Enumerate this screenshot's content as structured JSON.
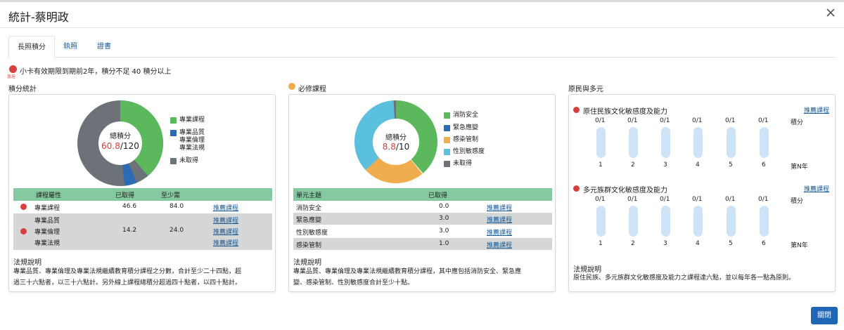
{
  "header": {
    "title": "統計-蔡明政"
  },
  "tabs": [
    {
      "label": "長照積分"
    },
    {
      "label": "執照"
    },
    {
      "label": "證書"
    }
  ],
  "notice": {
    "badge": "急迫",
    "text": "小卡有效期限到期前2年，積分不足 40 積分以上"
  },
  "panel1": {
    "title": "積分統計",
    "donut": {
      "center_label": "總積分",
      "value": "60.8",
      "total": "/120"
    },
    "legend": [
      {
        "label": "專業課程",
        "color": "#5cb85c"
      },
      {
        "label": "專業品質\n專業倫理\n專業法規",
        "color": "#2b6cb5"
      },
      {
        "label": "未取得",
        "color": "#6c7278"
      }
    ],
    "table": {
      "headers": [
        "課程屬性",
        "已取得",
        "至少需"
      ],
      "rows": [
        {
          "name": "專業課程",
          "got": "46.6",
          "need": "84.0",
          "link": "推薦課程"
        },
        {
          "name1": "專業品質",
          "name2": "專業倫理",
          "name3": "專業法規",
          "got": "14.2",
          "need": "24.0",
          "link1": "推薦課程",
          "link2": "推薦課程",
          "link3": "推薦課程"
        }
      ]
    },
    "law_title": "法規說明",
    "law_text_1": "專業品質、專業倫理及專業法規繼續教育積分課程之分數，合計至少二十四點，超",
    "law_text_2": "過三十六點者，以三十六點計。另外線上課程總積分超過四十點者，以四十點計。"
  },
  "panel2": {
    "title": "必修課程",
    "donut": {
      "center_label": "總積分",
      "value": "8.8",
      "total": "/10"
    },
    "legend": [
      {
        "label": "消防安全",
        "color": "#5cb85c"
      },
      {
        "label": "緊急應變",
        "color": "#2b6cb5"
      },
      {
        "label": "感染管制",
        "color": "#f0ad4e"
      },
      {
        "label": "性別敏感度",
        "color": "#5bc0de"
      },
      {
        "label": "未取得",
        "color": "#6c7278"
      }
    ],
    "table": {
      "headers": [
        "單元主題",
        "已取得"
      ],
      "rows": [
        {
          "name": "消防安全",
          "got": "0.0",
          "link": "推薦課程"
        },
        {
          "name": "緊急應變",
          "got": "3.0",
          "link": "推薦課程"
        },
        {
          "name": "性別敏感度",
          "got": "3.0",
          "link": "推薦課程"
        },
        {
          "name": "感染管制",
          "got": "1.0",
          "link": "推薦課程"
        }
      ]
    },
    "law_title": "法規說明",
    "law_text_1": "專業品質、專業倫理及專業法規繼續教育積分課程，其中應包括消防安全、緊急應",
    "law_text_2": "變、感染管制、性別敏感度合計至少十點。"
  },
  "panel3": {
    "title": "原民與多元",
    "group1": {
      "title": "原住民族文化敏感度及能力",
      "link": "推薦課程",
      "scores": [
        "0/1",
        "0/1",
        "0/1",
        "0/1",
        "0/1",
        "0/1"
      ],
      "fills": [
        0,
        0,
        0,
        0,
        0,
        0
      ],
      "years": [
        "1",
        "2",
        "3",
        "4",
        "5",
        "6"
      ],
      "score_label": "積分",
      "year_label": "第N年"
    },
    "group2": {
      "title": "多元族群文化敏感度及能力",
      "link": "推薦課程",
      "scores": [
        "0/1",
        "0/1",
        "0/1",
        "0/1",
        "0/1",
        "0/1"
      ],
      "fills": [
        0,
        0,
        0,
        0,
        0,
        0
      ],
      "years": [
        "1",
        "2",
        "3",
        "4",
        "5",
        "6"
      ],
      "score_label": "積分",
      "year_label": "第N年"
    },
    "law_title": "法規說明",
    "law_text": "原住民族、多元族群文化敏感度及能力之課程達六點，並以每年各一點為原則。"
  },
  "footer": {
    "close_label": "關閉"
  },
  "colors": {
    "red_dot": "#d9403d",
    "table_header": "#84c9a0",
    "link": "#1a5c98",
    "primary": "#1f66b5"
  }
}
